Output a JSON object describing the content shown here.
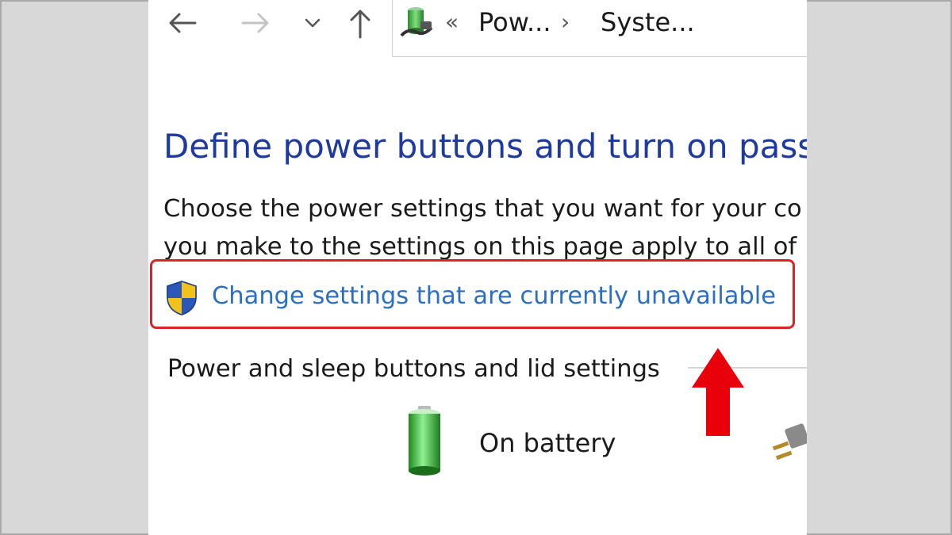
{
  "nav": {
    "back_icon": "arrow-left-icon",
    "forward_icon": "arrow-right-icon",
    "recent_icon": "chevron-down-icon",
    "up_icon": "arrow-up-icon"
  },
  "address": {
    "icon": "power-options-icon",
    "overflow_glyph": "«",
    "separator": "›",
    "crumbs": [
      "Pow...",
      "Syste..."
    ]
  },
  "page": {
    "title": "Define power buttons and turn on pass",
    "description_line1": "Choose the power settings that you want for your co",
    "description_line2": "you make to the settings on this page apply to all of",
    "change_link": "Change settings that are currently unavailable",
    "section_label": "Power and sleep buttons and lid settings",
    "on_battery_label": "On battery"
  },
  "colors": {
    "title": "#1e3a9e",
    "link": "#2a6fc4",
    "highlight": "#d9252a",
    "arrow": "#e8000a",
    "background": "#d8d8d8"
  }
}
